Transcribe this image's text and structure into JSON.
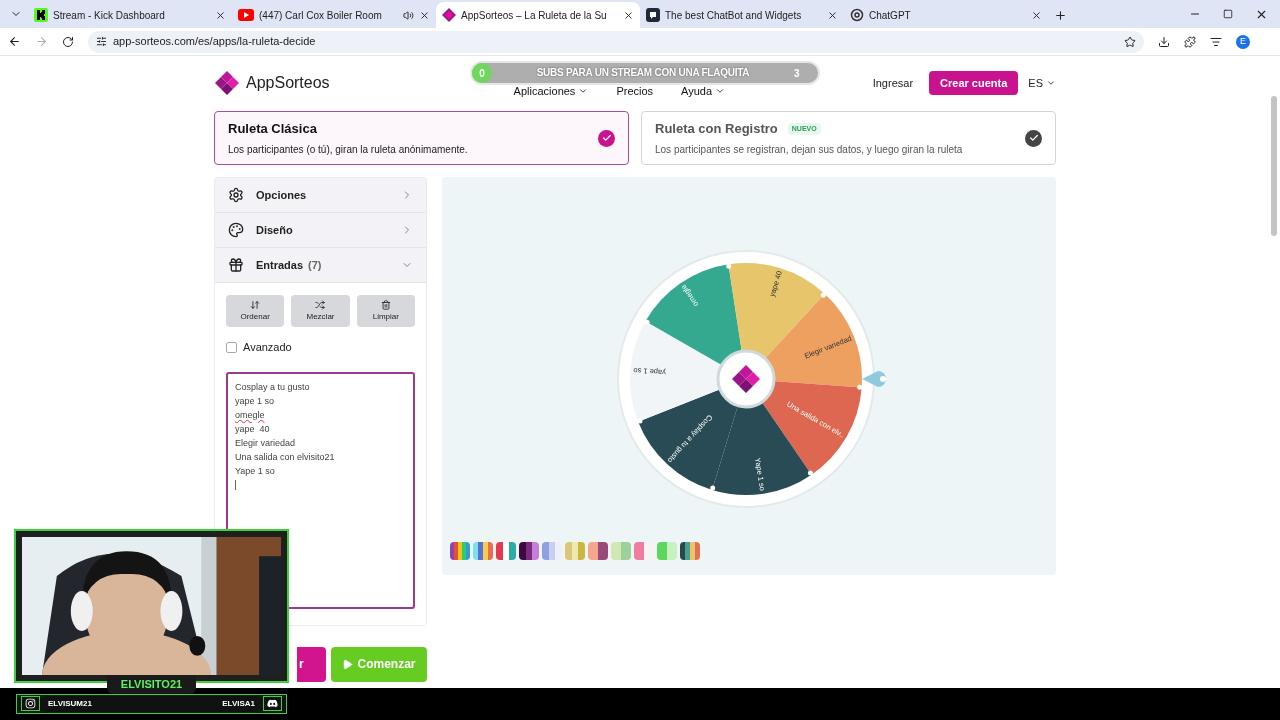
{
  "browser": {
    "tabs": [
      {
        "title": "Stream - Kick Dashboard",
        "kind": "kick",
        "selected": false,
        "audio": false
      },
      {
        "title": "(447) Carl Cox Boiler Room",
        "kind": "youtube",
        "selected": false,
        "audio": true
      },
      {
        "title": "AppSorteos – La Ruleta de la Su",
        "kind": "appsorteos",
        "selected": true,
        "audio": false
      },
      {
        "title": "The best ChatBot and Widgets",
        "kind": "chatbot",
        "selected": false,
        "audio": false
      },
      {
        "title": "ChatGPT",
        "kind": "chatgpt",
        "selected": false,
        "audio": false
      }
    ],
    "url": "app-sorteos.com/es/apps/la-ruleta-decide",
    "profile": "E"
  },
  "header": {
    "logo": "AppSorteos",
    "nav": [
      "Aplicaciones",
      "Precios",
      "Ayuda"
    ],
    "login": "Ingresar",
    "signup": "Crear cuenta",
    "language": "ES"
  },
  "stream_goal": {
    "start": "0",
    "title": "SUBS PARA UN STREAM CON UNA FLAQUITA",
    "goal": "3"
  },
  "modes": [
    {
      "title": "Ruleta Clásica",
      "description": "Los participantes (o tú), giran la ruleta anónimamente.",
      "selected": true
    },
    {
      "title": "Ruleta con Registro",
      "badge": "NUEVO",
      "description": "Los participantes se registran, dejan sus datos, y luego giran la ruleta",
      "selected": false
    }
  ],
  "sections": [
    {
      "label": "Opciones",
      "kind": "settings",
      "expanded": false
    },
    {
      "label": "Diseño",
      "kind": "design",
      "expanded": false
    },
    {
      "label": "Entradas",
      "kind": "entries",
      "count": "(7)",
      "expanded": true
    }
  ],
  "entry_tools": [
    {
      "label": "Ordenar",
      "kind": "sort"
    },
    {
      "label": "Mezclar",
      "kind": "shuffle"
    },
    {
      "label": "Limpiar",
      "kind": "clear"
    }
  ],
  "advanced": {
    "label": "Avanzado",
    "checked": false
  },
  "entries": [
    "Cosplay a tu gusto",
    "yape 1 so",
    "omegle",
    "yape  40",
    "Elegir variedad",
    "Una salida con elvisito21",
    "Yape 1 so"
  ],
  "actions": [
    {
      "label": "r",
      "kind": "secondary"
    },
    {
      "label": "Comenzar",
      "kind": "primary"
    }
  ],
  "wheel": {
    "segments": [
      {
        "label": "Cosplay a tu gusto",
        "color": "#284b55"
      },
      {
        "label": "yape 1 so",
        "color": "#f1f5f7"
      },
      {
        "label": "omegle",
        "color": "#35a98f"
      },
      {
        "label": "yape  40",
        "color": "#e6c56b"
      },
      {
        "label": "Elegir variedad",
        "color": "#eea061"
      },
      {
        "label": "Una salida con elv..",
        "color": "#dd6750"
      },
      {
        "label": "Yape 1 so",
        "color": "#284b55"
      }
    ]
  },
  "palettes": [
    {
      "stripes": [
        {
          "color": "#8e44ad"
        },
        {
          "color": "#e74c3c"
        },
        {
          "color": "#f1c40f"
        },
        {
          "color": "#2ecc71"
        },
        {
          "color": "#3498db"
        }
      ]
    },
    {
      "stripes": [
        {
          "color": "#7fe0e8"
        },
        {
          "color": "#5b6fd8"
        },
        {
          "color": "#f2d14b"
        },
        {
          "color": "#ef6a4f"
        }
      ]
    },
    {
      "stripes": [
        {
          "color": "#e53950"
        },
        {
          "color": "#ffffff"
        },
        {
          "color": "#2eaaa8"
        }
      ]
    },
    {
      "stripes": [
        {
          "color": "#3b0a3f"
        },
        {
          "color": "#7b2a80"
        },
        {
          "color": "#c57fd8"
        }
      ]
    },
    {
      "stripes": [
        {
          "color": "#8f9fe0"
        },
        {
          "color": "#c7cff2"
        },
        {
          "color": "#f2eef7"
        }
      ]
    },
    {
      "stripes": [
        {
          "color": "#d8c97a"
        },
        {
          "color": "#efe7b0"
        },
        {
          "color": "#c9b840"
        }
      ]
    },
    {
      "stripes": [
        {
          "color": "#f4a78c"
        },
        {
          "color": "#9a4a7a"
        }
      ]
    },
    {
      "stripes": [
        {
          "color": "#cfe8b4"
        },
        {
          "color": "#9ed19a"
        }
      ]
    },
    {
      "stripes": [
        {
          "color": "#f07ca0"
        },
        {
          "color": "#f7f3f5"
        }
      ]
    },
    {
      "stripes": [
        {
          "color": "#5cd65c"
        },
        {
          "color": "#c6f2c0"
        }
      ]
    },
    {
      "stripes": [
        {
          "color": "#2b4650"
        },
        {
          "color": "#46a08b"
        },
        {
          "color": "#e9c46a"
        },
        {
          "color": "#e76f51"
        }
      ]
    }
  ],
  "webcam": {
    "name": "ELVISITO21",
    "socials": [
      {
        "kind": "instagram",
        "handle": "ELVISUM21"
      },
      {
        "kind": "discord",
        "handle": "ELVISA1"
      }
    ]
  }
}
